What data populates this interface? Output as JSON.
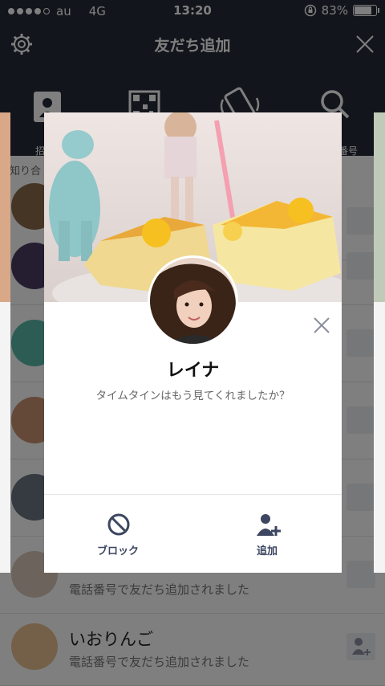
{
  "status": {
    "carrier": "au",
    "network": "4G",
    "time": "13:20",
    "battery": "83%",
    "battery_level": 0.83
  },
  "header": {
    "title": "友だち追加"
  },
  "tabs": [
    {
      "label": "招",
      "icon": "invite-icon"
    },
    {
      "label": "",
      "icon": "qr-code-icon"
    },
    {
      "label": "",
      "icon": "shake-icon"
    },
    {
      "label": "話番号",
      "icon": "search-icon"
    }
  ],
  "list": {
    "section": "知り合",
    "rows": [
      {
        "name": "",
        "sub": ""
      },
      {
        "name": "",
        "sub": ""
      },
      {
        "name": "",
        "sub": ""
      },
      {
        "name": "",
        "sub": ""
      },
      {
        "name": "",
        "sub": ""
      },
      {
        "name": "",
        "sub": "電話番号で友だち追加されました"
      },
      {
        "name": "いおりんご",
        "sub": "電話番号で友だち追加されました"
      }
    ]
  },
  "modal": {
    "name": "レイナ",
    "status": "タイムタインはもう見てくれましたか？",
    "actions": {
      "block": "ブロック",
      "add": "追加"
    }
  },
  "colors": {
    "header_bg": "#252a36",
    "action_color": "#3c4660"
  }
}
